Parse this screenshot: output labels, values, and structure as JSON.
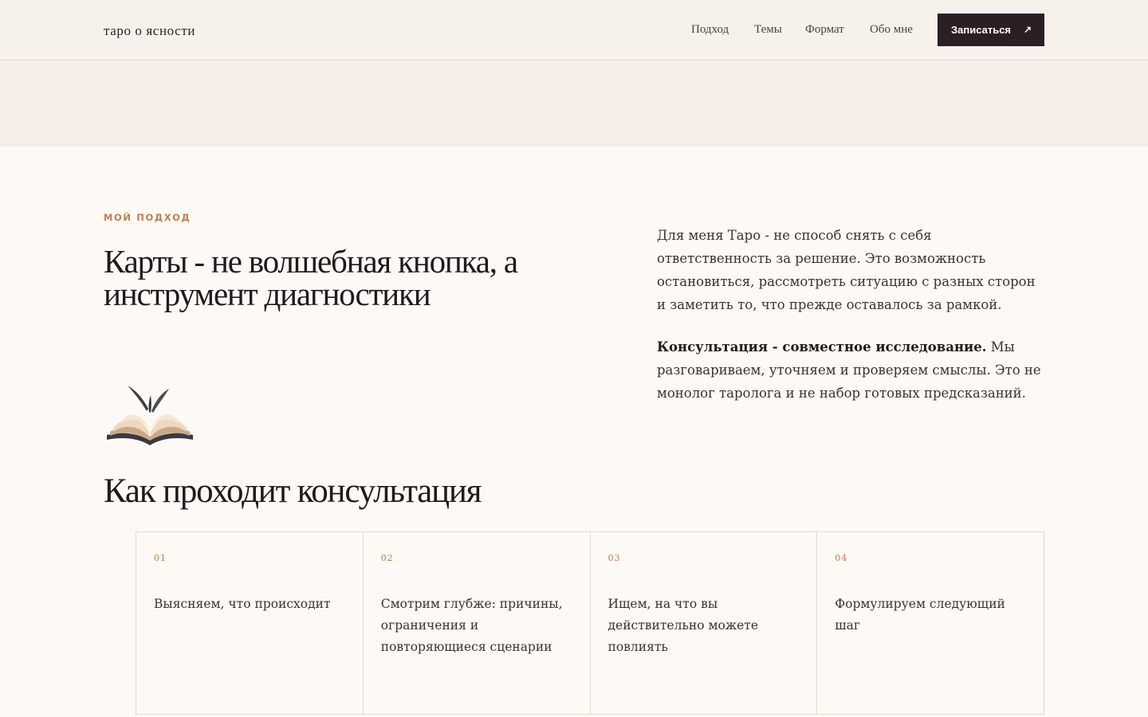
{
  "header": {
    "brand": "таро о ясности",
    "nav": [
      "Подход",
      "Темы",
      "Формат",
      "Обо мне"
    ],
    "cta_label": "Записаться",
    "cta_icon": "arrow-up-right-icon"
  },
  "approach": {
    "eyebrow": "МОЙ ПОДХОД",
    "headline": "Карты - не волшебная кнопка, а инструмент диагностики",
    "paragraph1": "Для меня Таро - не способ снять с себя ответственность за решение. Это возможность остановиться, рассмотреть ситуацию с разных сторон и заметить то, что прежде оставалось за рамкой.",
    "paragraph2_bold": "Консультация - совместное исследование.",
    "paragraph2_rest": " Мы разговариваем, уточняем и проверяем смыслы. Это не монолог таролога и не набор готовых предсказаний."
  },
  "process": {
    "title": "Как проходит консультация",
    "steps": [
      {
        "num": "01",
        "text": "Выясняем, что происходит"
      },
      {
        "num": "02",
        "text": "Смотрим глубже: причины, ограничения и повторяющиеся сценарии"
      },
      {
        "num": "03",
        "text": "Ищем, на что вы действительно можете повлиять"
      },
      {
        "num": "04",
        "text": "Формулируем следующий шаг"
      }
    ]
  },
  "colors": {
    "accent": "#c07d52",
    "cta_bg": "#2b1f24",
    "page_bg": "#fdf9f5",
    "header_bg": "#f7f1ec"
  }
}
